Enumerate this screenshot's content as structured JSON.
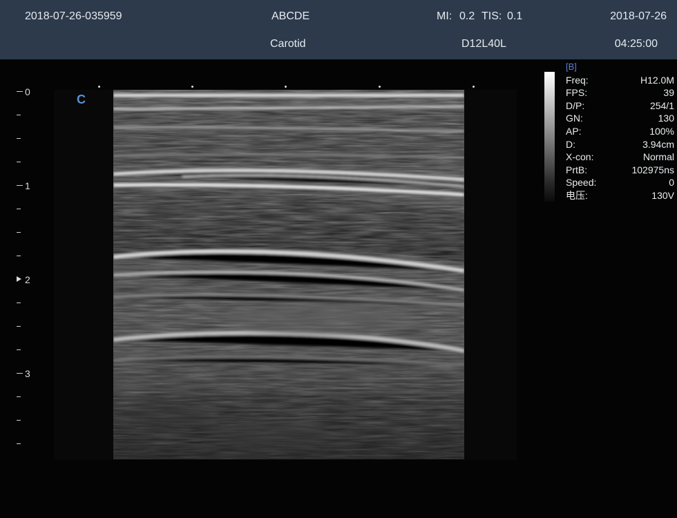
{
  "header": {
    "study_id": "2018-07-26-035959",
    "patient_name": "ABCDE",
    "mi_label": "MI:",
    "mi_value": "0.2",
    "tis_label": "TIS:",
    "tis_value": "0.1",
    "date": "2018-07-26",
    "preset": "Carotid",
    "probe": "D12L40L",
    "time": "04:25:00"
  },
  "image": {
    "orientation_mark": "C",
    "depth_labels": [
      "0",
      "1",
      "2",
      "3"
    ]
  },
  "params": {
    "mode": "[B]",
    "rows": [
      {
        "label": "Freq:",
        "value": "H12.0M"
      },
      {
        "label": "FPS:",
        "value": "39"
      },
      {
        "label": "D/P:",
        "value": "254/1"
      },
      {
        "label": "GN:",
        "value": "130"
      },
      {
        "label": "AP:",
        "value": "100%"
      },
      {
        "label": "D:",
        "value": "3.94cm"
      },
      {
        "label": "X-con:",
        "value": "Normal"
      },
      {
        "label": "PrtB:",
        "value": "102975ns"
      },
      {
        "label": "Speed:",
        "value": "0"
      },
      {
        "label": "电压:",
        "value": "130V"
      }
    ]
  },
  "colors": {
    "header_bg": "#2c3a4b",
    "accent_blue": "#5b8fd0"
  }
}
